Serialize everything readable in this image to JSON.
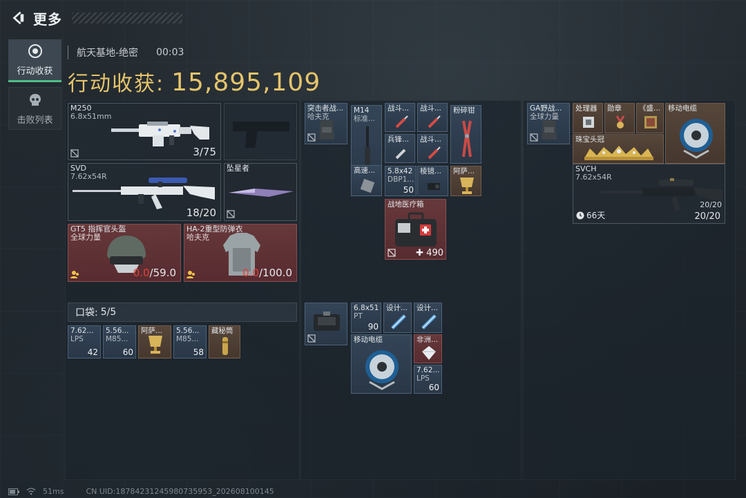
{
  "header": {
    "title": "更多"
  },
  "tabs": [
    {
      "label": "行动收获",
      "icon": "loot-icon"
    },
    {
      "label": "击败列表",
      "icon": "skull-icon"
    }
  ],
  "raid": {
    "map": "航天基地-绝密",
    "time": "00:03"
  },
  "harvest": {
    "label": "行动收获:",
    "value": "15,895,109"
  },
  "loadout": {
    "m250": {
      "name": "M250",
      "caliber": "6.8x51mm",
      "ammo": "3/75"
    },
    "svd": {
      "name": "SVD",
      "caliber": "7.62x54R",
      "ammo": "18/20"
    },
    "melee": {
      "name": "坠星者"
    },
    "helmet": {
      "name": "GT5 指挥官头盔",
      "maker": "全球力量",
      "cur": "0.0",
      "max": "/59.0"
    },
    "armor": {
      "name": "HA-2重型防弹衣",
      "maker": "哈夫克",
      "cur": "0.0",
      "max": "/100.0"
    }
  },
  "pocket": {
    "label": "口袋:",
    "value": "5/5"
  },
  "pocket_items": [
    {
      "name": "7.62...",
      "sub": "LPS",
      "count": "42"
    },
    {
      "name": "5.56...",
      "sub": "M85...",
      "count": "60"
    },
    {
      "name": "阿萨...",
      "sub": "",
      "count": ""
    },
    {
      "name": "5.56...",
      "sub": "M85...",
      "count": "58"
    },
    {
      "name": "藏秘筒",
      "sub": "",
      "count": ""
    }
  ],
  "backpack_top": {
    "vest": {
      "name": "突击者战...",
      "sub": "哈夫克"
    },
    "m14": {
      "name": "M14",
      "sub": "标准..."
    },
    "items": [
      {
        "name": "战斗..."
      },
      {
        "name": "战斗..."
      },
      {
        "name": "粉碎钳"
      },
      {
        "name": "兵锋..."
      },
      {
        "name": "战斗..."
      },
      {
        "name": "高速..."
      },
      {
        "name": "5.8x42",
        "sub": "DBP1...",
        "count": "50"
      },
      {
        "name": "棱镜..."
      },
      {
        "name": "阿萨..."
      }
    ],
    "medkit": {
      "name": "战地医疗箱",
      "count": "490"
    }
  },
  "backpack_bottom": {
    "items": [
      {
        "name": "6.8x51",
        "sub": "PT",
        "count": "90"
      },
      {
        "name": "设计..."
      },
      {
        "name": "设计..."
      },
      {
        "name": "移动电缆"
      },
      {
        "name": "非洲..."
      },
      {
        "name": "7.62...",
        "sub": "LPS",
        "count": "60"
      }
    ]
  },
  "safebox": {
    "vest": {
      "name": "GA野战...",
      "sub": "全球力量"
    },
    "items": [
      {
        "name": "处理器"
      },
      {
        "name": "勋章"
      },
      {
        "name": "《盛..."
      },
      {
        "name": "移动电缆"
      },
      {
        "name": "珠宝头冠"
      }
    ],
    "svch": {
      "name": "SVCH",
      "caliber": "7.62x54R",
      "mag": "20/20",
      "ammo": "20/20",
      "days": "66天"
    }
  },
  "footer": {
    "ping": "51ms",
    "uid": "CN UID:18784231245980735953_202608100145"
  },
  "colors": {
    "gold": "#e6c46b",
    "accent_green": "#4fc08a",
    "durability_red": "#e0453e"
  }
}
